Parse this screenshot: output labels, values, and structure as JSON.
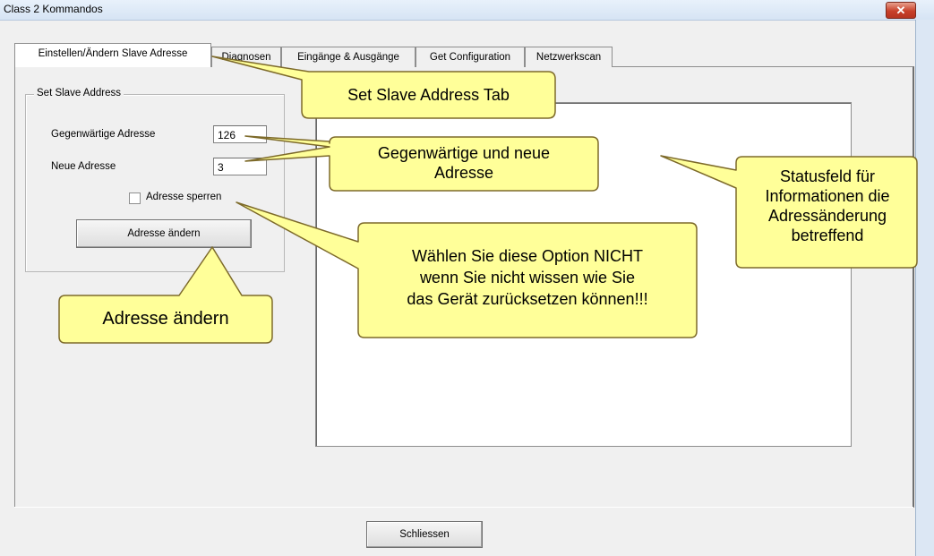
{
  "window": {
    "title": "Class 2 Kommandos",
    "close_label": "✕"
  },
  "tabs": [
    {
      "label": "Einstellen/Ändern Slave Adresse",
      "active": true
    },
    {
      "label": "Diagnosen",
      "active": false
    },
    {
      "label": "Eingänge & Ausgänge",
      "active": false
    },
    {
      "label": "Get Configuration",
      "active": false
    },
    {
      "label": "Netzwerkscan",
      "active": false
    }
  ],
  "slave_address": {
    "group_title": "Set Slave Address",
    "current_label": "Gegenwärtige Adresse",
    "current_value": "126",
    "new_label": "Neue Adresse",
    "new_value": "3",
    "lock_label": "Adresse sperren",
    "lock_checked": false,
    "change_button": "Adresse ändern"
  },
  "footer": {
    "close_button": "Schliessen"
  },
  "callouts": {
    "tab": "Set Slave Address Tab",
    "addresses": [
      "Gegenwärtige und neue",
      "Adresse"
    ],
    "status": [
      "Statusfeld für",
      "Informationen die",
      "Adressänderung",
      "betreffend"
    ],
    "warning": [
      "Wählen Sie diese Option NICHT",
      "wenn Sie nicht wissen wie Sie",
      "das Gerät zurücksetzen können!!!"
    ],
    "change": "Adresse ändern"
  },
  "colors": {
    "callout_fill": "#ffff99",
    "callout_border": "#7d6a2a"
  }
}
